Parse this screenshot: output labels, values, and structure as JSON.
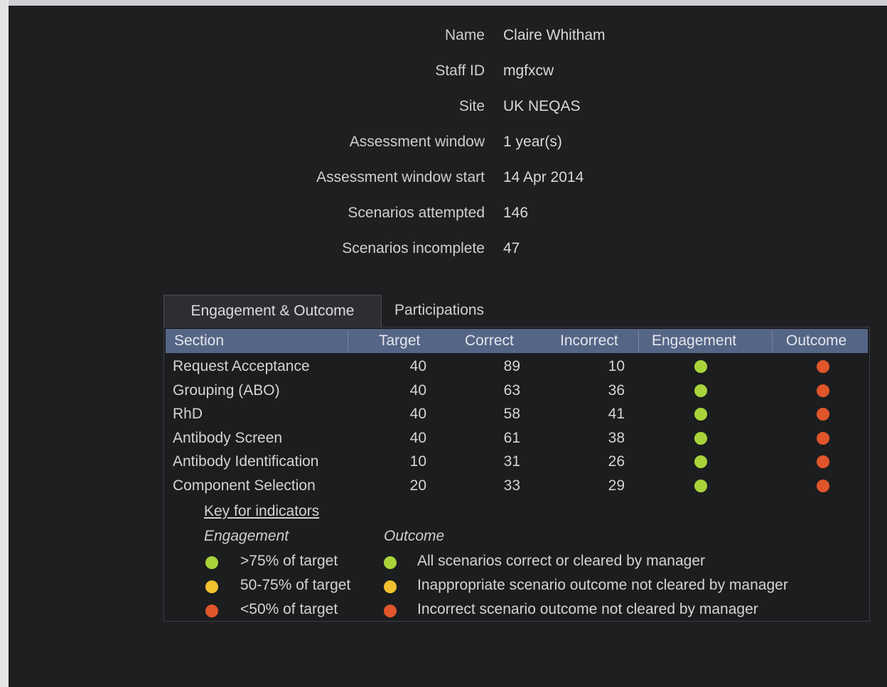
{
  "colors": {
    "green": "#a8d43a",
    "yellow": "#f2c12e",
    "red": "#e0552a",
    "header_bg": "#556586"
  },
  "profile": {
    "name_label": "Name",
    "name_value": "Claire Whitham",
    "staff_label": "Staff ID",
    "staff_value": "mgfxcw",
    "site_label": "Site",
    "site_value": "UK NEQAS",
    "window_label": "Assessment window",
    "window_value": "1 year(s)",
    "window_start_label": "Assessment window start",
    "window_start_value": "14 Apr 2014",
    "attempted_label": "Scenarios attempted",
    "attempted_value": "146",
    "incomplete_label": "Scenarios incomplete",
    "incomplete_value": "47"
  },
  "tabs": {
    "active": "Engagement & Outcome",
    "inactive": "Participations"
  },
  "table": {
    "headers": {
      "section": "Section",
      "target": "Target",
      "correct": "Correct",
      "incorrect": "Incorrect",
      "engagement": "Engagement",
      "outcome": "Outcome"
    },
    "rows": [
      {
        "section": "Request Acceptance",
        "target": "40",
        "correct": "89",
        "incorrect": "10",
        "engagement": "green",
        "outcome": "red"
      },
      {
        "section": "Grouping (ABO)",
        "target": "40",
        "correct": "63",
        "incorrect": "36",
        "engagement": "green",
        "outcome": "red"
      },
      {
        "section": "RhD",
        "target": "40",
        "correct": "58",
        "incorrect": "41",
        "engagement": "green",
        "outcome": "red"
      },
      {
        "section": "Antibody Screen",
        "target": "40",
        "correct": "61",
        "incorrect": "38",
        "engagement": "green",
        "outcome": "red"
      },
      {
        "section": "Antibody Identification",
        "target": "10",
        "correct": "31",
        "incorrect": "26",
        "engagement": "green",
        "outcome": "red"
      },
      {
        "section": "Component Selection",
        "target": "20",
        "correct": "33",
        "incorrect": "29",
        "engagement": "green",
        "outcome": "red"
      }
    ]
  },
  "key": {
    "title": "Key for indicators",
    "engagement_heading": "Engagement",
    "outcome_heading": "Outcome",
    "engagement_items": [
      {
        "color": "green",
        "text": ">75% of target"
      },
      {
        "color": "yellow",
        "text": "50-75% of target"
      },
      {
        "color": "red",
        "text": "<50% of target"
      }
    ],
    "outcome_items": [
      {
        "color": "green",
        "text": "All scenarios correct or cleared by manager"
      },
      {
        "color": "yellow",
        "text": "Inappropriate scenario outcome not cleared by manager"
      },
      {
        "color": "red",
        "text": "Incorrect scenario outcome not cleared by manager"
      }
    ]
  }
}
